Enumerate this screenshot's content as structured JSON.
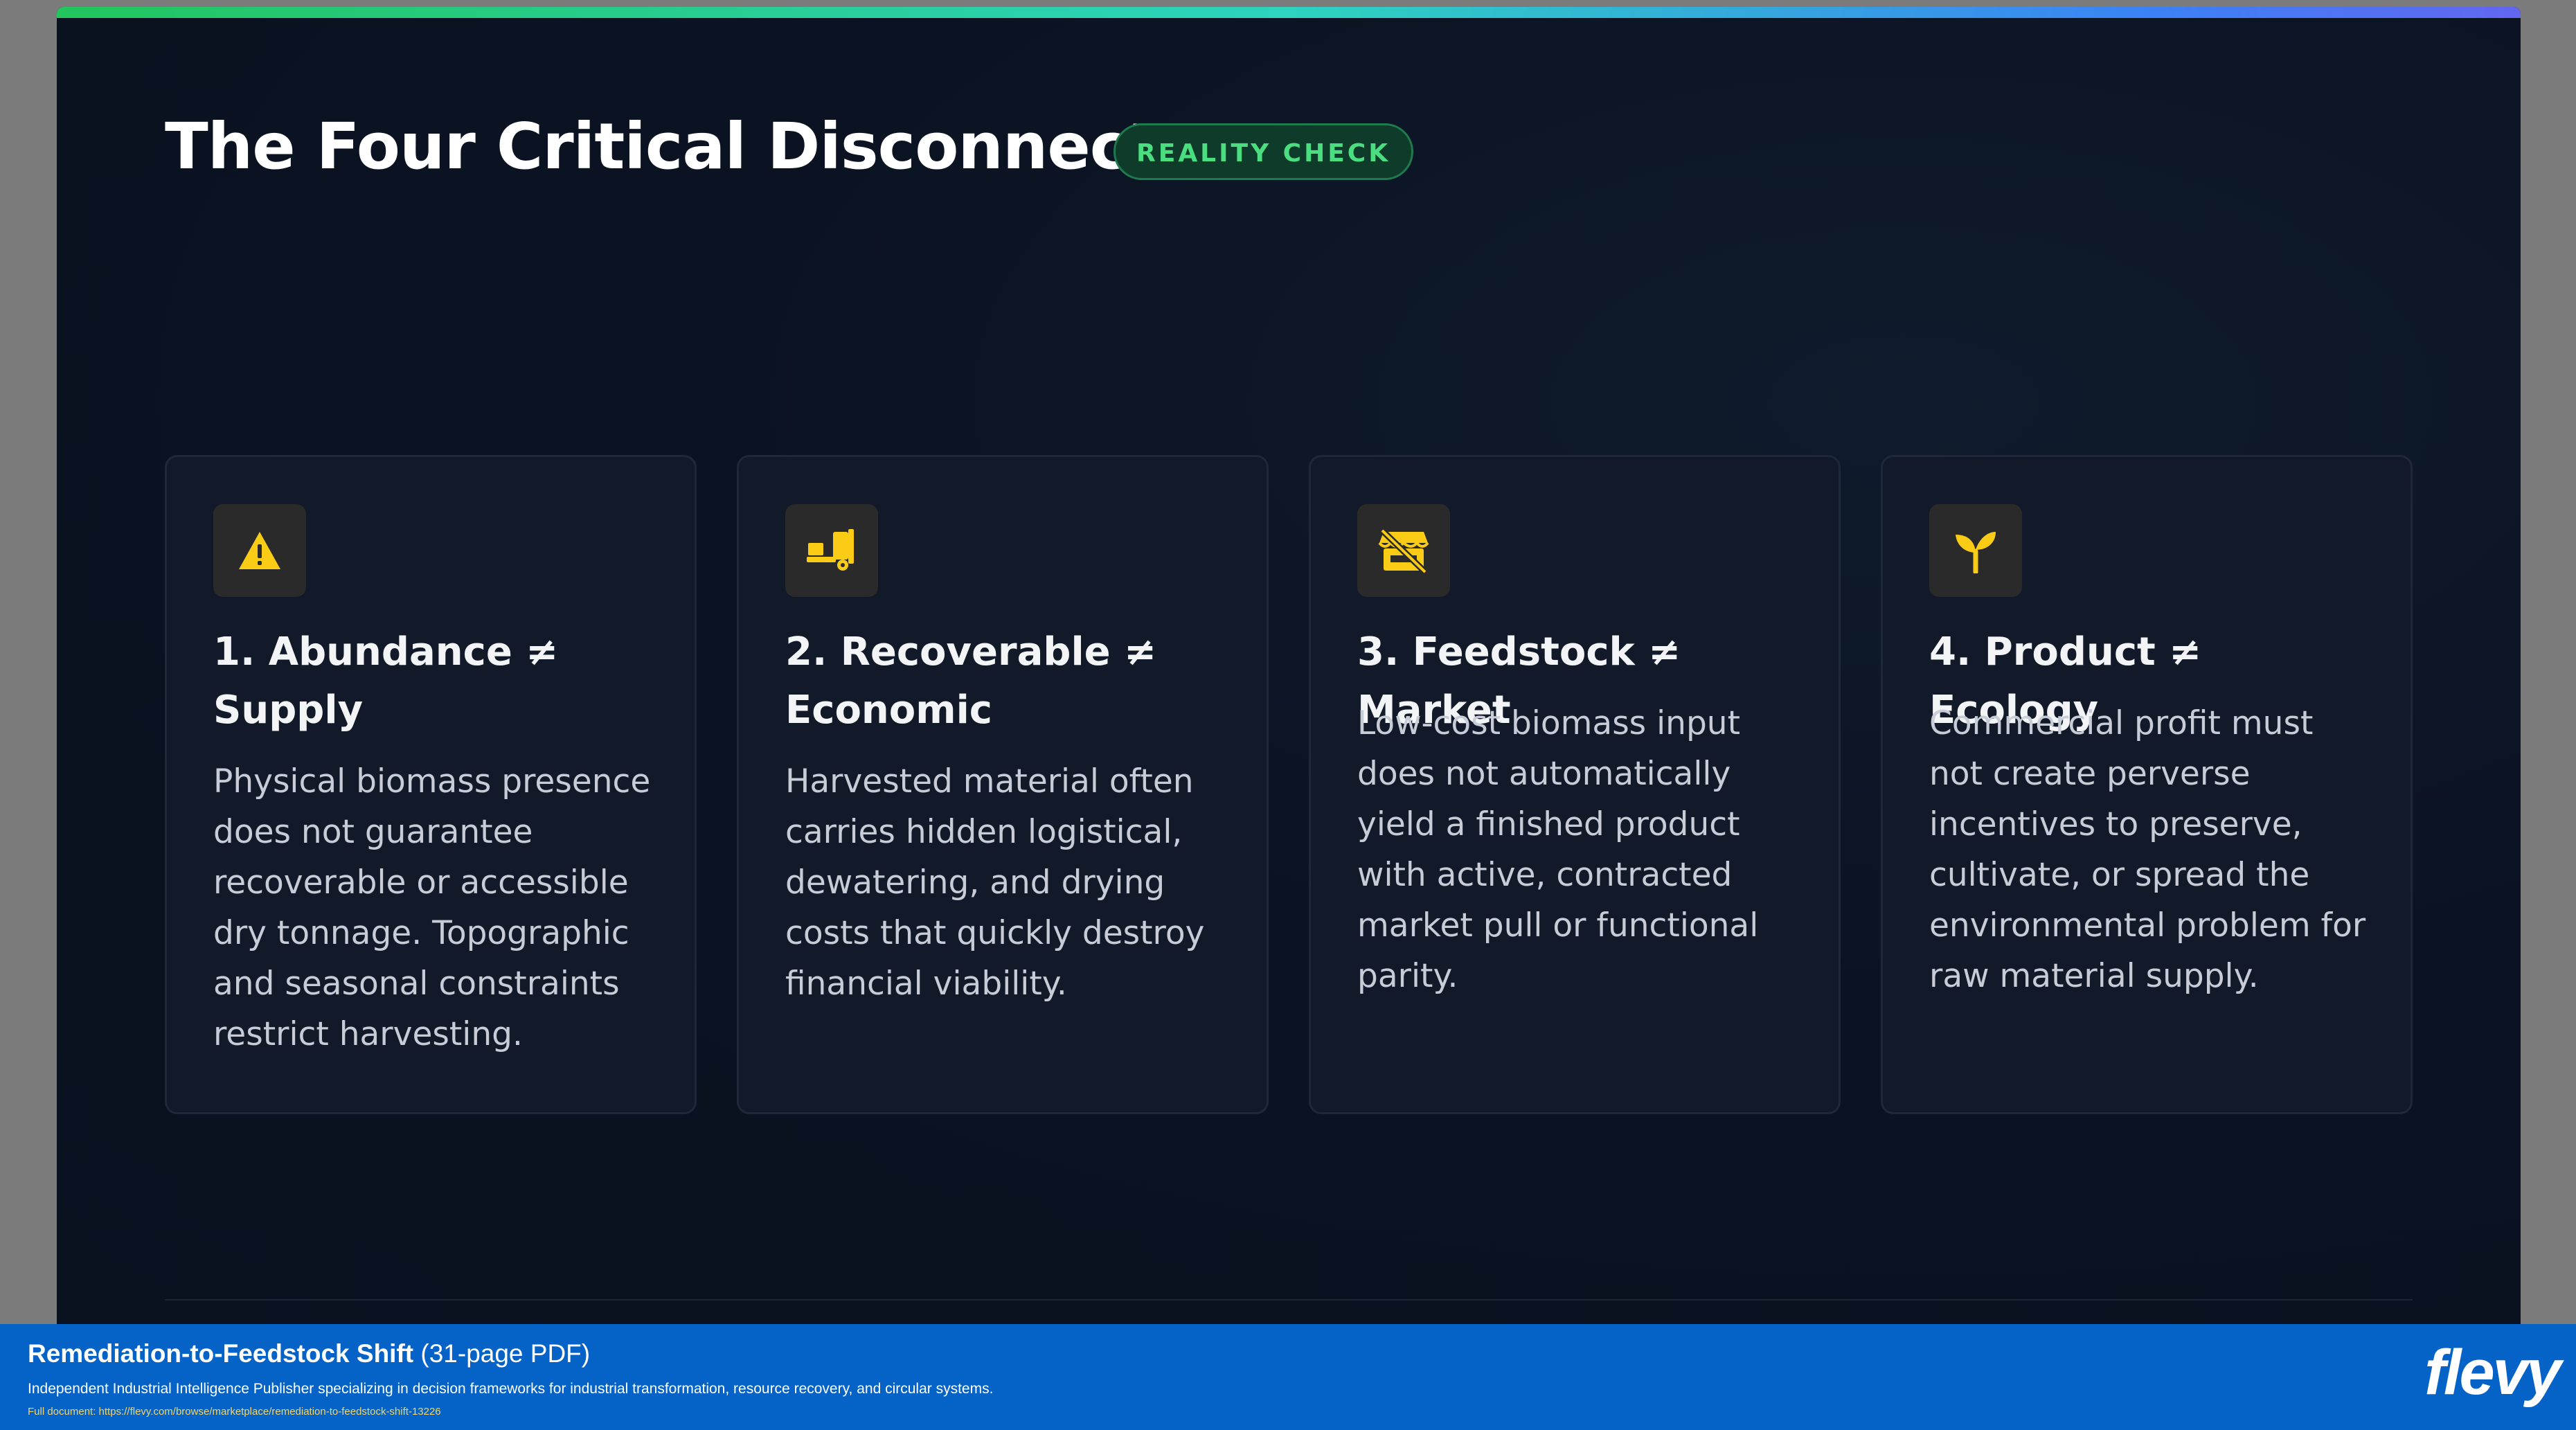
{
  "slide": {
    "title": "The Four Critical Disconnects",
    "badge": "REALITY CHECK",
    "accent_color": "#22c55e",
    "icon_color": "#facc15"
  },
  "cards": [
    {
      "icon": "warning-triangle-icon",
      "title": "1. Abundance ≠ Supply",
      "body": "Physical biomass presence does not guarantee recoverable or accessible dry tonnage. Topographic and seasonal constraints restrict harvesting."
    },
    {
      "icon": "forklift-icon",
      "title": "2. Recoverable ≠ Economic",
      "body": "Harvested material often carries hidden logistical, dewatering, and drying costs that quickly destroy financial viability."
    },
    {
      "icon": "store-off-icon",
      "title": "3. Feedstock ≠ Market",
      "body": "Low-cost biomass input does not automatically yield a finished product with active, contracted market pull or functional parity."
    },
    {
      "icon": "sprout-icon",
      "title": "4. Product ≠ Ecology",
      "body": "Commercial profit must not create perverse incentives to preserve, cultivate, or spread the environmental problem for raw material supply."
    }
  ],
  "footer": {
    "doc_title": "Remediation-to-Feedstock Shift",
    "doc_meta": "(31-page PDF)",
    "description": "Independent Industrial Intelligence Publisher specializing in decision frameworks for industrial transformation, resource recovery, and circular systems.",
    "link": "Full document: https://flevy.com/browse/marketplace/remediation-to-feedstock-shift-13226",
    "logo": "flevy",
    "background_color": "#0563c8"
  }
}
